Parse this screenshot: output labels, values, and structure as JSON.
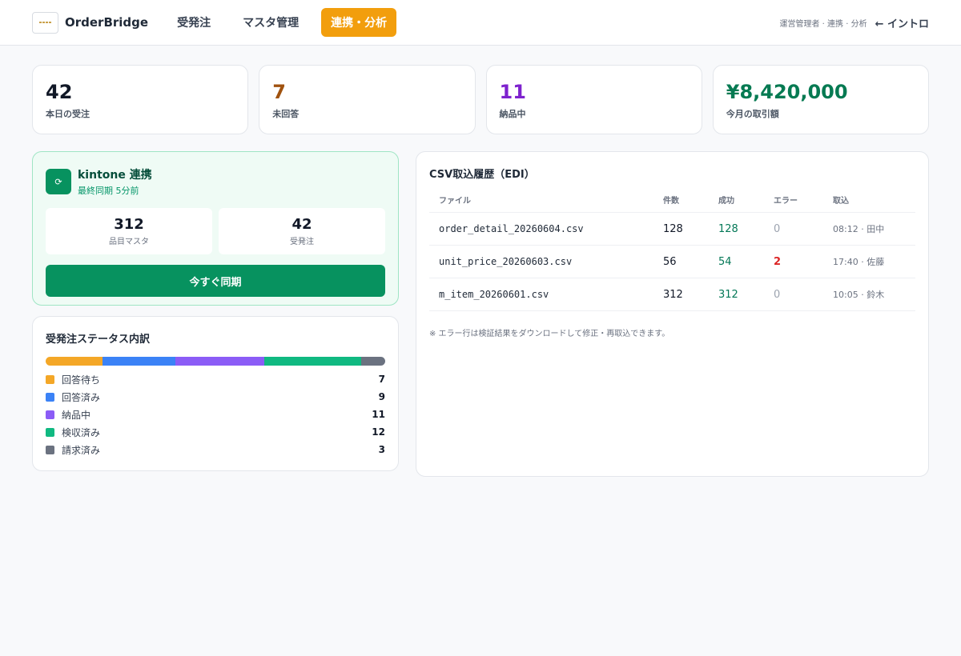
{
  "header": {
    "brand": "OrderBridge",
    "logo_icon": "orderbridge-logo",
    "nav": [
      {
        "label": "受発注",
        "active": false
      },
      {
        "label": "マスタ管理",
        "active": false
      },
      {
        "label": "連携・分析",
        "active": true
      }
    ],
    "role": "運営管理者 · 連携 · 分析",
    "back_label": "← イントロ"
  },
  "stats": [
    {
      "value": "42",
      "label": "本日の受注",
      "color": "#111827"
    },
    {
      "value": "7",
      "label": "未回答",
      "color": "#a0520f"
    },
    {
      "value": "11",
      "label": "納品中",
      "color": "#7e22ce"
    },
    {
      "value": "¥8,420,000",
      "label": "今月の取引額",
      "color": "#067a52"
    }
  ],
  "kintone": {
    "icon": "sync-icon",
    "title": "kintone 連携",
    "subtitle": "最終同期 5分前",
    "counts": [
      {
        "value": "312",
        "label": "品目マスタ"
      },
      {
        "value": "42",
        "label": "受発注"
      }
    ],
    "sync_label": "今すぐ同期"
  },
  "status_breakdown": {
    "title": "受発注ステータス内訳",
    "items": [
      {
        "label": "回答待ち",
        "count": "7",
        "value": 7,
        "color": "#f4a727"
      },
      {
        "label": "回答済み",
        "count": "9",
        "value": 9,
        "color": "#3b82f6"
      },
      {
        "label": "納品中",
        "count": "11",
        "value": 11,
        "color": "#8b5cf6"
      },
      {
        "label": "検収済み",
        "count": "12",
        "value": 12,
        "color": "#10b981"
      },
      {
        "label": "請求済み",
        "count": "3",
        "value": 3,
        "color": "#6b7280"
      }
    ]
  },
  "csv": {
    "title": "CSV取込履歴（EDI）",
    "columns": [
      "ファイル",
      "件数",
      "成功",
      "エラー",
      "取込"
    ],
    "rows": [
      {
        "file": "order_detail_20260604.csv",
        "count": "128",
        "success": "128",
        "error": "0",
        "imported": "08:12 · 田中"
      },
      {
        "file": "unit_price_20260603.csv",
        "count": "56",
        "success": "54",
        "error": "2",
        "imported": "17:40 · 佐藤"
      },
      {
        "file": "m_item_20260601.csv",
        "count": "312",
        "success": "312",
        "error": "0",
        "imported": "10:05 · 鈴木"
      }
    ],
    "note": "※ エラー行は検証結果をダウンロードして修正・再取込できます。"
  }
}
